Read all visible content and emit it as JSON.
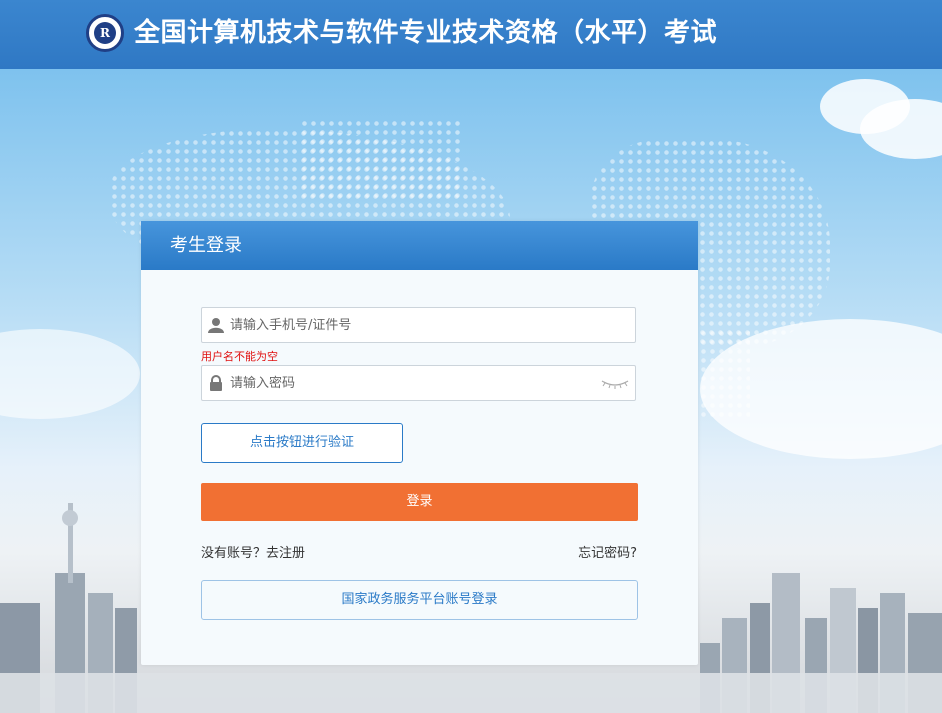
{
  "header": {
    "title": "全国计算机技术与软件专业技术资格（水平）考试",
    "logo_icon": "exam-emblem-icon"
  },
  "login": {
    "heading": "考生登录",
    "username": {
      "placeholder": "请输入手机号/证件号",
      "value": "",
      "icon": "user-icon",
      "error": "用户名不能为空"
    },
    "password": {
      "placeholder": "请输入密码",
      "value": "",
      "icon": "lock-icon",
      "toggle_icon": "eye-closed-icon"
    },
    "verify_button": "点击按钮进行验证",
    "login_button": "登录",
    "register_link": "没有账号？去注册",
    "forgot_link": "忘记密码?",
    "gov_login_button": "国家政务服务平台账号登录"
  },
  "colors": {
    "header_blue": "#2f78c4",
    "login_orange": "#f17033",
    "link_blue": "#2a7ac7",
    "error_red": "#e01010"
  }
}
